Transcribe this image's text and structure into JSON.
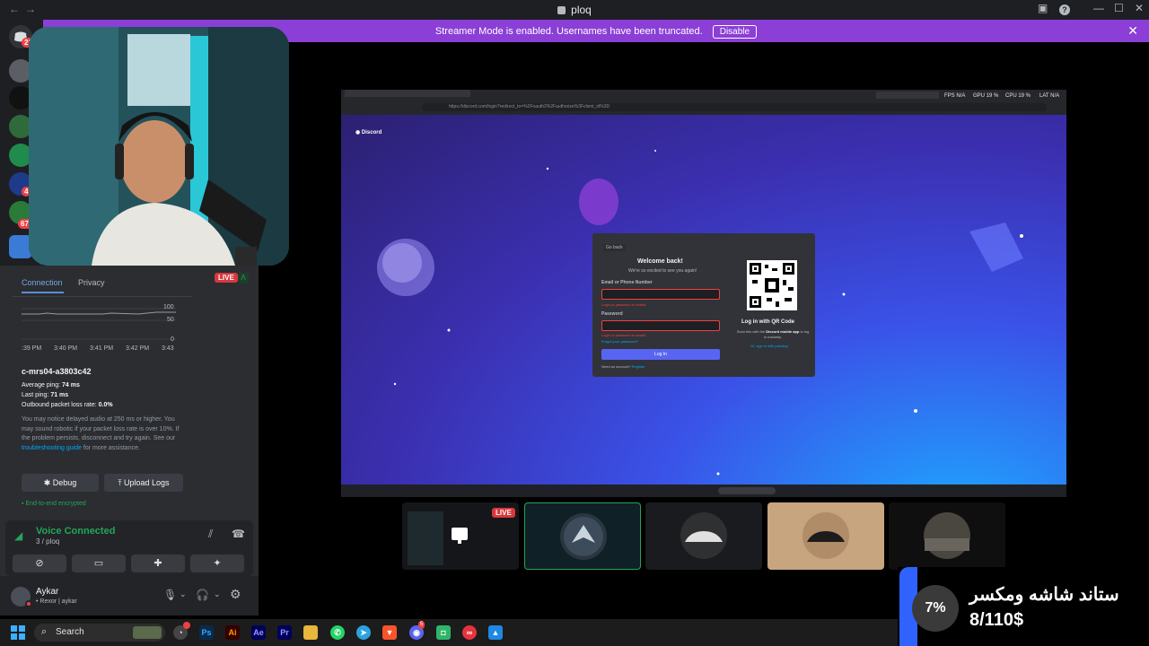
{
  "window": {
    "title": "ploq"
  },
  "banner": {
    "message": "Streamer Mode is enabled. Usernames have been truncated.",
    "disable_label": "Disable"
  },
  "rail": {
    "badges": [
      "21",
      "4",
      "678"
    ]
  },
  "rtc": {
    "tabs": [
      "Connection",
      "Privacy"
    ],
    "graph_ticks": [
      "100",
      "50",
      "0"
    ],
    "graph_times": [
      ":39 PM",
      "3:40 PM",
      "3:41 PM",
      "3:42 PM",
      "3:43"
    ],
    "server": "c-mrs04-a3803c42",
    "avg_ping_label": "Average ping:",
    "avg_ping": "74 ms",
    "last_ping_label": "Last ping:",
    "last_ping": "71 ms",
    "loss_label": "Outbound packet loss rate:",
    "loss": "0.0%",
    "notice_pre": "You may notice delayed audio at 250 ms or higher. You may sound robotic if your packet loss rate is over 10%. If the problem persists, disconnect and try again. See our ",
    "notice_link": "troubleshooting guide",
    "notice_post": " for more assistance.",
    "debug_label": "Debug",
    "upload_label": "Upload Logs",
    "encrypted": "End-to-end encrypted"
  },
  "live_badge": "LIVE",
  "voice": {
    "status": "Voice Connected",
    "channel": "3 / ploq"
  },
  "user": {
    "name": "Aykar",
    "status": "• Rexor | aykar"
  },
  "stream": {
    "url": "https://discord.com/login?redirect_to=%2Foauth2%2Fauthorize%3Fclient_id%3D",
    "stats": [
      "FPS N/A",
      "GPU 19 %",
      "CPU 19 %",
      "LAT N/A"
    ],
    "brand": "Discord",
    "login": {
      "back": "Go back",
      "title": "Welcome back!",
      "subtitle": "We're so excited to see you again!",
      "email_label": "Email or Phone Number",
      "email_error": "Login or password is invalid.",
      "password_label": "Password",
      "password_error": "Login or password is invalid.",
      "forgot": "Forgot your password?",
      "login_button": "Log In",
      "register_pre": "Need an account?",
      "register_link": "Register",
      "qr_title": "Log in with QR Code",
      "qr_desc_pre": "Scan this with the ",
      "qr_desc_bold": "Discord mobile app",
      "qr_desc_post": " to log in instantly.",
      "passkey": "Or, sign in with passkey"
    }
  },
  "thumb_live": "LIVE",
  "overlay": {
    "percent": "7%",
    "product": "ستاند شاشه ومكسر",
    "price": "8/110$"
  },
  "taskbar": {
    "search": "Search",
    "badge": "5"
  },
  "colors": {
    "accent": "#5865f2",
    "banner": "#8b3fd6",
    "live": "#da373c",
    "voice_green": "#23a55a",
    "link": "#00a8fc"
  }
}
